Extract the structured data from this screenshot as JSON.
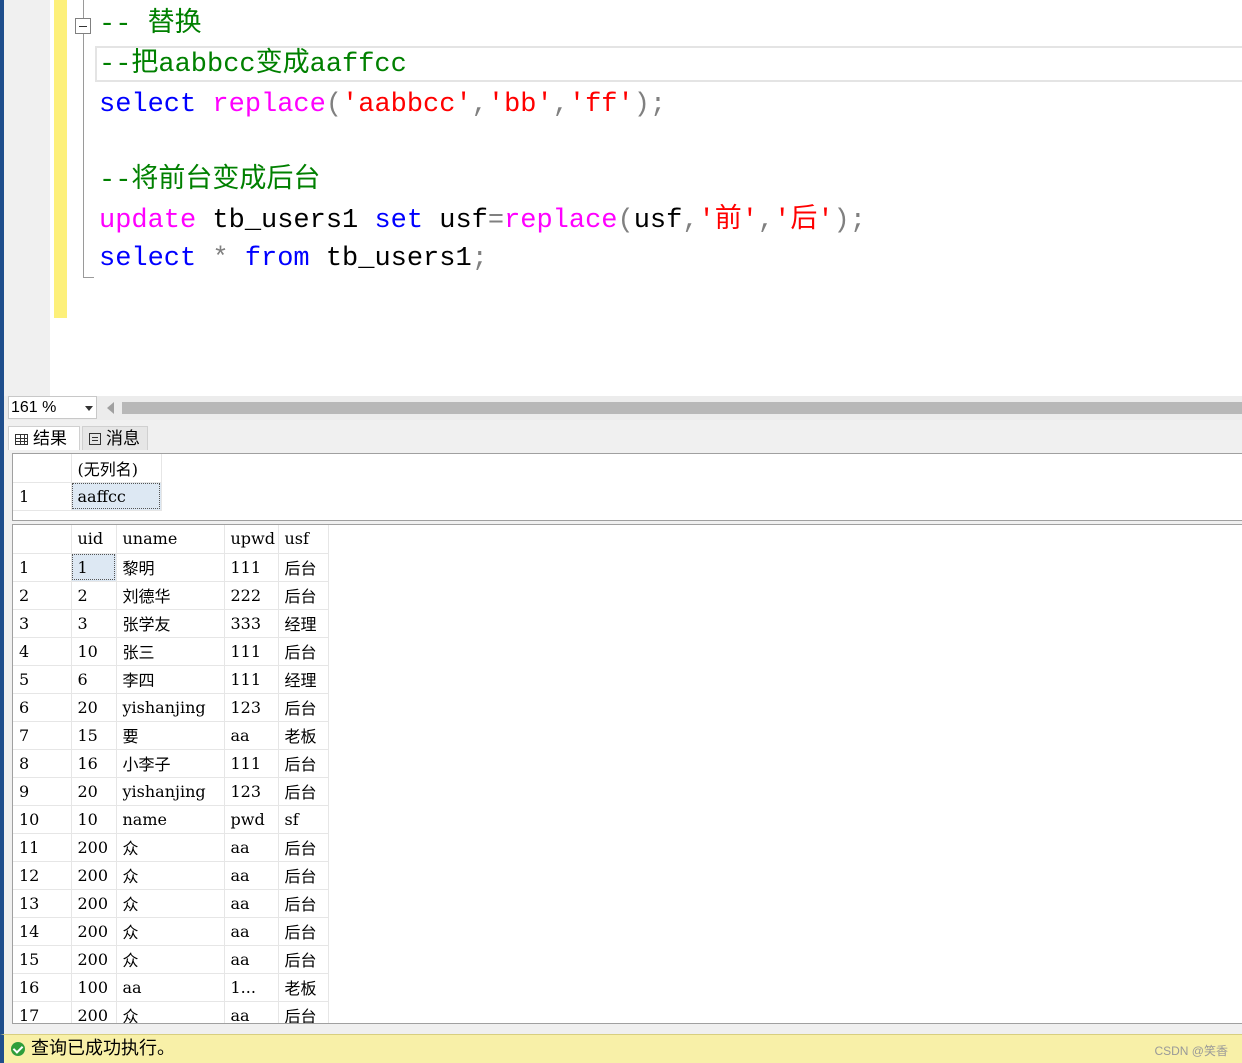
{
  "editor": {
    "lines": [
      [
        {
          "t": "-- 替换",
          "c": "cm"
        }
      ],
      [
        {
          "t": "--把aabbcc变成aaffcc",
          "c": "cm"
        }
      ],
      [
        {
          "t": "select",
          "c": "kw"
        },
        {
          "t": " ",
          "c": "tx"
        },
        {
          "t": "replace",
          "c": "fn"
        },
        {
          "t": "(",
          "c": "gr"
        },
        {
          "t": "'aabbcc'",
          "c": "str"
        },
        {
          "t": ",",
          "c": "gr"
        },
        {
          "t": "'bb'",
          "c": "str"
        },
        {
          "t": ",",
          "c": "gr"
        },
        {
          "t": "'ff'",
          "c": "str"
        },
        {
          "t": ");",
          "c": "gr"
        }
      ],
      [],
      [
        {
          "t": "--将前台变成后台",
          "c": "cm"
        }
      ],
      [
        {
          "t": "update",
          "c": "fn"
        },
        {
          "t": " tb_users1 ",
          "c": "tx"
        },
        {
          "t": "set",
          "c": "kw"
        },
        {
          "t": " usf",
          "c": "tx"
        },
        {
          "t": "=",
          "c": "gr"
        },
        {
          "t": "replace",
          "c": "fn"
        },
        {
          "t": "(",
          "c": "gr"
        },
        {
          "t": "usf",
          "c": "tx"
        },
        {
          "t": ",",
          "c": "gr"
        },
        {
          "t": "'前'",
          "c": "str"
        },
        {
          "t": ",",
          "c": "gr"
        },
        {
          "t": "'后'",
          "c": "str"
        },
        {
          "t": ");",
          "c": "gr"
        }
      ],
      [
        {
          "t": "select",
          "c": "kw"
        },
        {
          "t": " ",
          "c": "tx"
        },
        {
          "t": "*",
          "c": "gr"
        },
        {
          "t": " ",
          "c": "tx"
        },
        {
          "t": "from",
          "c": "kw"
        },
        {
          "t": " tb_users1",
          "c": "tx"
        },
        {
          "t": ";",
          "c": "gr"
        }
      ]
    ]
  },
  "toolbar": {
    "zoom": "161 %"
  },
  "tabs": {
    "results": "结果",
    "messages": "消息"
  },
  "result1": {
    "columns": [
      "(无列名)"
    ],
    "rows": [
      [
        "1",
        "aaffcc"
      ]
    ]
  },
  "result2": {
    "columns": [
      "uid",
      "uname",
      "upwd",
      "usf"
    ],
    "rows": [
      [
        "1",
        "1",
        "黎明",
        "111",
        "后台"
      ],
      [
        "2",
        "2",
        "刘德华",
        "222",
        "后台"
      ],
      [
        "3",
        "3",
        "张学友",
        "333",
        "经理"
      ],
      [
        "4",
        "10",
        "张三",
        "111",
        "后台"
      ],
      [
        "5",
        "6",
        "李四",
        "111",
        "经理"
      ],
      [
        "6",
        "20",
        "yishanjing",
        "123",
        "后台"
      ],
      [
        "7",
        "15",
        "要",
        "aa",
        "老板"
      ],
      [
        "8",
        "16",
        "小李子",
        "111",
        "后台"
      ],
      [
        "9",
        "20",
        "yishanjing",
        "123",
        "后台"
      ],
      [
        "10",
        "10",
        "name",
        "pwd",
        "sf"
      ],
      [
        "11",
        "200",
        "众",
        "aa",
        "后台"
      ],
      [
        "12",
        "200",
        "众",
        "aa",
        "后台"
      ],
      [
        "13",
        "200",
        "众",
        "aa",
        "后台"
      ],
      [
        "14",
        "200",
        "众",
        "aa",
        "后台"
      ],
      [
        "15",
        "200",
        "众",
        "aa",
        "后台"
      ],
      [
        "16",
        "100",
        "aa",
        "1...",
        "老板"
      ],
      [
        "17",
        "200",
        "众",
        "aa",
        "后台"
      ]
    ]
  },
  "status": {
    "text": "查询已成功执行。",
    "watermark": "CSDN @笑香"
  }
}
